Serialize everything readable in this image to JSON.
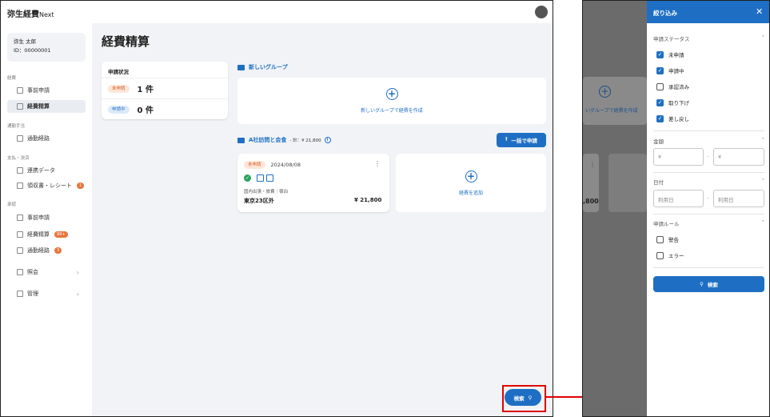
{
  "app": {
    "logo": "弥生経費",
    "logo_suffix": "Next",
    "user_name": "弥生 太郎",
    "user_id": "ID：00000001"
  },
  "sidebar": {
    "sec_expense": "経費",
    "item_prior": "事前申請",
    "item_settle": "経費精算",
    "sec_commute": "通勤手当",
    "item_commute": "通勤経路",
    "sec_payment": "支払・決済",
    "item_link": "連携データ",
    "item_receipt": "領収書・レシート",
    "badge_receipt": "1",
    "sec_approval": "承認",
    "item_appr_prior": "事前申請",
    "item_appr_settle": "経費精算",
    "badge_appr_settle": "99+",
    "item_appr_commute": "通勤経路",
    "badge_appr_commute": "3",
    "item_inquiry": "照会",
    "item_admin": "管理"
  },
  "main": {
    "title": "経費精算",
    "status_card_title": "申請状況",
    "status_unsubmitted": "未申請",
    "count_unsubmitted": "1 件",
    "status_submitting": "申請中",
    "count_submitting": "0 件",
    "new_group": "新しいグループ",
    "create_in_new_group": "新しいグループで経費を作成",
    "group_name": "A社訪問と会食",
    "group_total": "- 計：¥ 21,800",
    "bulk_submit": "一括で申請",
    "expense_status": "未申請",
    "expense_date": "2024/08/08",
    "expense_category": "国内出張・旅費｜宿泊",
    "expense_place": "東京23区外",
    "expense_amount": "¥ 21,800",
    "add_expense": "経費を追加",
    "search_button": "検索"
  },
  "right": {
    "dim_text": "いグループで経費を作成",
    "dim_amount": ",800",
    "panel_title": "絞り込み",
    "sec_status": "申請ステータス",
    "statuses": [
      {
        "label": "未申請",
        "checked": true
      },
      {
        "label": "申請中",
        "checked": true
      },
      {
        "label": "承認済み",
        "checked": false
      },
      {
        "label": "取り下げ",
        "checked": true
      },
      {
        "label": "差し戻し",
        "checked": true
      }
    ],
    "sec_amount": "金額",
    "yen_from": "¥",
    "yen_to": "¥",
    "sec_date": "日付",
    "date_from": "利用日",
    "date_to": "利用日",
    "sec_rule": "申請ルール",
    "rule_warning": "警告",
    "rule_error": "エラー",
    "search_button": "検索"
  },
  "colors": {
    "accent": "#1e6fc4",
    "alert": "#e00000",
    "badge": "#e8763c"
  }
}
